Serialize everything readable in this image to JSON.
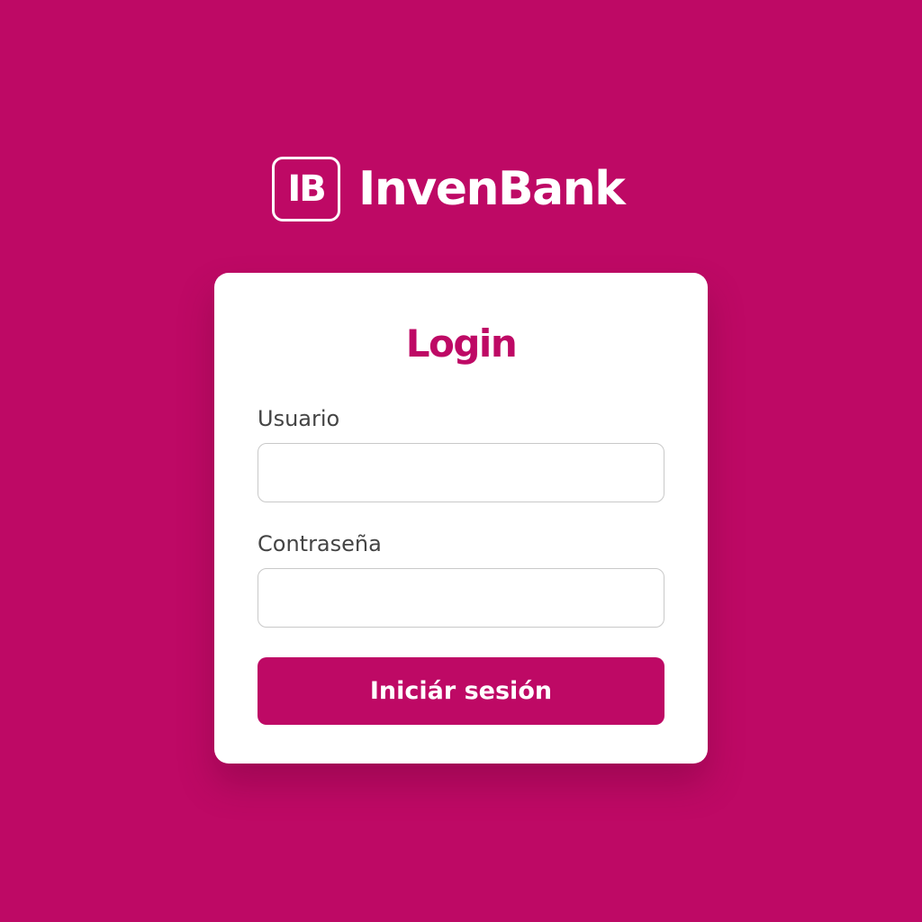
{
  "brand": {
    "logo_mark": "IB",
    "name": "InvenBank"
  },
  "login_card": {
    "title": "Login",
    "username_label": "Usuario",
    "username_value": "",
    "username_placeholder": "",
    "password_label": "Contraseña",
    "password_value": "",
    "password_placeholder": "",
    "submit_label": "Iniciár sesión"
  },
  "colors": {
    "background": "#BE0965",
    "accent": "#BE0965",
    "card": "#FFFFFF",
    "input_border": "#C9C9C9"
  }
}
